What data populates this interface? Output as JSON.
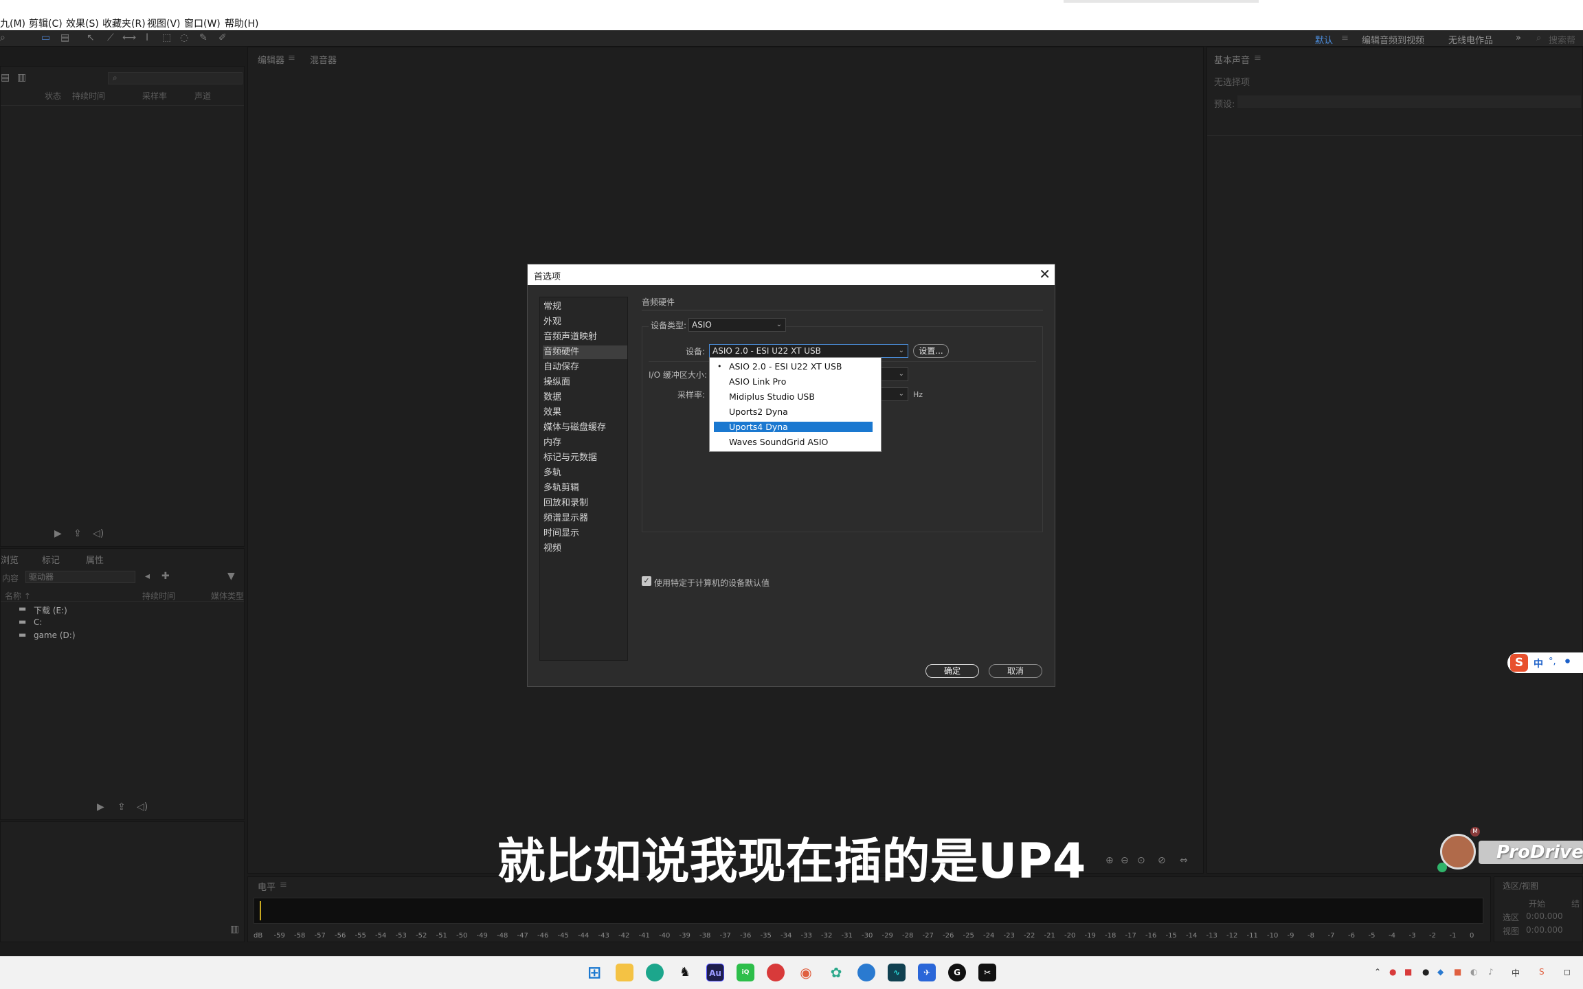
{
  "menu": [
    "九(M)",
    "剪辑(C)",
    "效果(S)",
    "收藏夹(R)",
    "视图(V)",
    "窗口(W)",
    "帮助(H)"
  ],
  "workspaces": {
    "default": "默认",
    "edit_to_video": "编辑音频到视频",
    "radio": "无线电作品",
    "search_placeholder": "搜索帮"
  },
  "files_panel": {
    "columns": [
      "状态",
      "持续时间",
      "采样率",
      "声道"
    ]
  },
  "media_panel": {
    "tabs": [
      "浏览",
      "标记",
      "属性"
    ],
    "content_label": "内容",
    "content_value": "驱动器",
    "columns": [
      "名称 ↑",
      "持续时间",
      "媒体类型"
    ],
    "drives": [
      "下载 (E:)",
      "C:",
      "game (D:)"
    ]
  },
  "editor_tabs": [
    "编辑器",
    "混音器"
  ],
  "right_panel": {
    "title": "基本声音",
    "no_selection": "无选择项",
    "preset_label": "预设:"
  },
  "level_panel": {
    "title": "电平",
    "scale": [
      "dB",
      "-59",
      "-58",
      "-57",
      "-56",
      "-55",
      "-54",
      "-53",
      "-52",
      "-51",
      "-50",
      "-49",
      "-48",
      "-47",
      "-46",
      "-45",
      "-44",
      "-43",
      "-42",
      "-41",
      "-40",
      "-39",
      "-38",
      "-37",
      "-36",
      "-35",
      "-34",
      "-33",
      "-32",
      "-31",
      "-30",
      "-29",
      "-28",
      "-27",
      "-26",
      "-25",
      "-24",
      "-23",
      "-22",
      "-21",
      "-20",
      "-19",
      "-18",
      "-17",
      "-16",
      "-15",
      "-14",
      "-13",
      "-12",
      "-11",
      "-10",
      "-9",
      "-8",
      "-7",
      "-6",
      "-5",
      "-4",
      "-3",
      "-2",
      "-1",
      "0"
    ]
  },
  "selection_panel": {
    "title": "选区/视图",
    "col_start": "开始",
    "col_end": "结",
    "row_selection": "选区",
    "row_view": "视图",
    "sel_start": "0:00.000",
    "view_start": "0:00.000"
  },
  "dialog": {
    "title": "首选项",
    "categories": [
      "常规",
      "外观",
      "音频声道映射",
      "音频硬件",
      "自动保存",
      "操纵面",
      "数据",
      "效果",
      "媒体与磁盘缓存",
      "内存",
      "标记与元数据",
      "多轨",
      "多轨剪辑",
      "回放和录制",
      "频谱显示器",
      "时间显示",
      "视频"
    ],
    "selected_category": "音频硬件",
    "section_title": "音频硬件",
    "device_type_label": "设备类型:",
    "device_type_value": "ASIO",
    "device_label": "设备:",
    "device_value": "ASIO 2.0 - ESI U22 XT USB",
    "settings_button": "设置...",
    "io_buffer_label": "I/O 缓冲区大小:",
    "sample_rate_label": "采样率:",
    "sample_rate_unit": "Hz",
    "checkbox_label": "使用特定于计算机的设备默认值",
    "checkbox_checked": true,
    "ok_button": "确定",
    "cancel_button": "取消"
  },
  "device_dropdown": {
    "options": [
      "ASIO 2.0 - ESI U22 XT USB",
      "ASIO Link Pro",
      "Midiplus Studio USB",
      "Uports2 Dyna",
      "Uports4 Dyna",
      "Waves SoundGrid ASIO"
    ],
    "current_index": 0,
    "highlighted_index": 4
  },
  "subtitle": "就比如说我现在插的是UP4",
  "watermark": "ProDriver",
  "ime": {
    "lang": "中"
  },
  "taskbar": {
    "apps": [
      "start",
      "explorer",
      "edge",
      "qq",
      "audition",
      "iqiyi",
      "netease-music",
      "maps",
      "chatgpt",
      "cloud",
      "wave",
      "feishu",
      "capcut",
      "capcut2"
    ],
    "audition_label": "Au"
  }
}
